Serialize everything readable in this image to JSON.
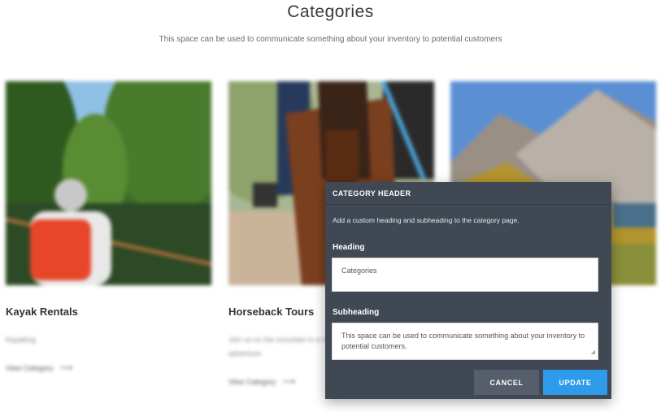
{
  "page": {
    "title": "Categories",
    "subtitle": "This space can be used to communicate something about your inventory to potential customers"
  },
  "cards": [
    {
      "title": "Kayak Rentals",
      "description": "Kayaking",
      "link": "View Category"
    },
    {
      "title": "Horseback Tours",
      "description": "Join us on the mountain in a horseback adventure.",
      "link": "View Category"
    },
    {
      "title": "",
      "description": "",
      "link": ""
    }
  ],
  "modal": {
    "header": "CATEGORY HEADER",
    "description": "Add a custom heading and subheading to the category page.",
    "heading_label": "Heading",
    "heading_value": "Categories",
    "subheading_label": "Subheading",
    "subheading_value": "This space can be used to communicate something about your inventory to potential customers.",
    "cancel_label": "CANCEL",
    "update_label": "UPDATE"
  },
  "icons": {
    "arrow": "arrow-right-icon",
    "resize": "resize-handle-icon"
  },
  "colors": {
    "modal_bg": "#3f4853",
    "update_button": "#2d9bea",
    "cancel_button": "#555e6a"
  }
}
